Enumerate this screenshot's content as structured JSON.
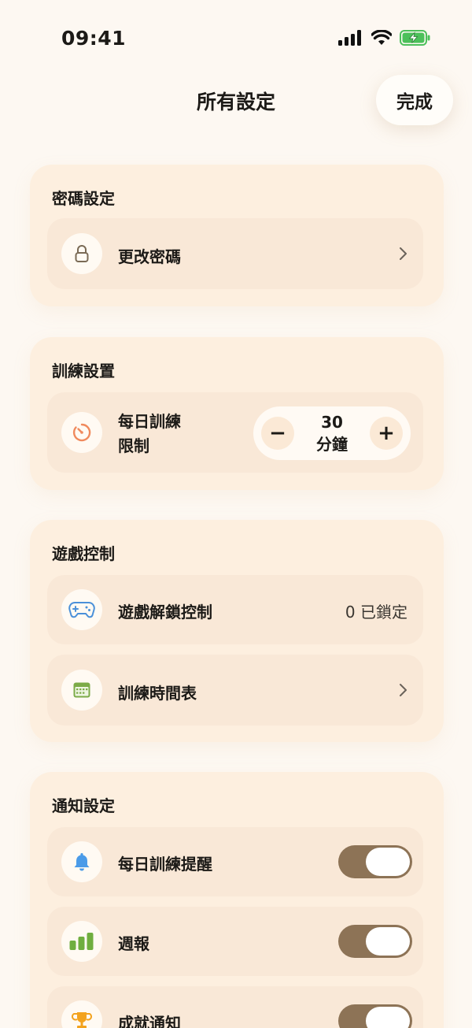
{
  "status_bar": {
    "time": "09:41"
  },
  "header": {
    "title": "所有設定",
    "done_label": "完成"
  },
  "password_section": {
    "title": "密碼設定",
    "change_password_label": "更改密碼"
  },
  "training_section": {
    "title": "訓練設置",
    "daily_limit_label_line1": "每日訓練",
    "daily_limit_label_line2": "限制",
    "daily_limit_value": "30",
    "daily_limit_unit": "分鐘",
    "minus_label": "−",
    "plus_label": "+"
  },
  "game_section": {
    "title": "遊戲控制",
    "unlock_label": "遊戲解鎖控制",
    "unlock_value": "0 已鎖定",
    "schedule_label": "訓練時間表"
  },
  "notification_section": {
    "title": "通知設定",
    "items": [
      {
        "label": "每日訓練提醒",
        "enabled": true
      },
      {
        "label": "週報",
        "enabled": true
      },
      {
        "label": "成就通知",
        "enabled": true
      }
    ]
  },
  "colors": {
    "background": "#fdf8f2",
    "card": "#fdefdf",
    "row": "#f9e8d7",
    "toggle_on": "#8d7356",
    "timer_icon": "#f08a5d",
    "game_icon": "#4a90d9",
    "calendar_icon": "#7cab48",
    "bell_icon": "#4a9be8",
    "chart_icon": "#6fae3f",
    "trophy_icon": "#f3a31f"
  },
  "icons": [
    "lock-icon",
    "timer-icon",
    "gamepad-icon",
    "calendar-icon",
    "bell-icon",
    "bar-chart-icon",
    "trophy-icon"
  ]
}
